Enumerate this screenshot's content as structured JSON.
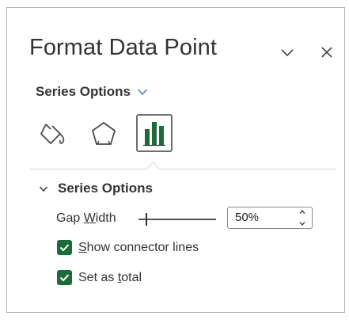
{
  "pane": {
    "title": "Format Data Point"
  },
  "section_menu": {
    "label": "Series Options"
  },
  "tabs": [
    {
      "name": "Fill & Line",
      "icon": "paint-bucket-icon",
      "selected": false
    },
    {
      "name": "Effects",
      "icon": "pentagon-icon",
      "selected": false
    },
    {
      "name": "Series Options",
      "icon": "bar-chart-icon",
      "selected": true
    }
  ],
  "group": {
    "label": "Series Options",
    "expanded": true
  },
  "gap_width": {
    "label_pre": "Gap ",
    "label_mnemonic": "W",
    "label_post": "idth",
    "value": "50%",
    "slider_fraction": 0.1
  },
  "options": [
    {
      "label_pre": "",
      "label_mnemonic": "S",
      "label_post": "how connector lines",
      "checked": true
    },
    {
      "label_pre": "Set as ",
      "label_mnemonic": "t",
      "label_post": "otal",
      "checked": true
    }
  ],
  "colors": {
    "checkbox": "#1e6b3a",
    "chart_icon": "#1e6b3a",
    "accent_chevron": "#4a7fd4"
  }
}
